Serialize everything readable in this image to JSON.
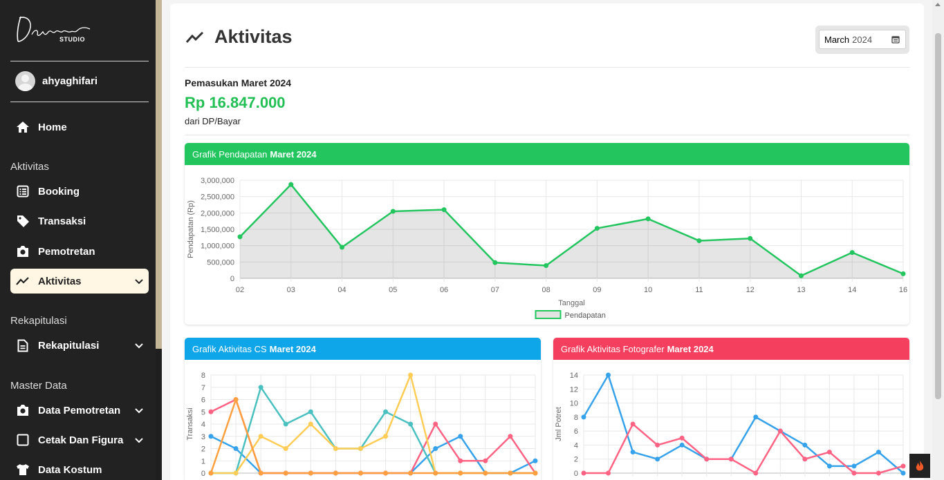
{
  "sidebar": {
    "logo_text": "Danapa STUDIO",
    "user": {
      "name": "ahyaghifari"
    },
    "home": {
      "label": "Home"
    },
    "sections": {
      "aktivitas": "Aktivitas",
      "rekapitulasi": "Rekapitulasi",
      "master": "Master Data"
    },
    "items": {
      "booking": "Booking",
      "transaksi": "Transaksi",
      "pemotretan": "Pemotretan",
      "aktivitas": "Aktivitas",
      "rekapitulasi": "Rekapitulasi",
      "data_pemotretan": "Data Pemotretan",
      "cetak": "Cetak Dan Figura",
      "kostum": "Data Kostum"
    }
  },
  "header": {
    "title": "Aktivitas",
    "month_label": "March",
    "year_label": "2024"
  },
  "income": {
    "title": "Pemasukan Maret 2024",
    "value": "Rp 16.847.000",
    "subtitle": "dari DP/Bayar"
  },
  "colors": {
    "green": "#22c55e",
    "blue": "#0ea5e9",
    "red": "#f43f5e"
  },
  "panels": {
    "revenue": {
      "title": "Grafik Pendapatan",
      "period": "Maret 2024"
    },
    "cs": {
      "title": "Grafik Aktivitas CS",
      "period": "Maret 2024"
    },
    "photo": {
      "title": "Grafik Aktivitas Fotografer",
      "period": "Maret 2024"
    }
  },
  "chart_data": [
    {
      "type": "line",
      "xlabel": "Tanggal",
      "ylabel": "Pendapatan (Rp)",
      "categories": [
        "02",
        "03",
        "04",
        "05",
        "06",
        "07",
        "08",
        "09",
        "10",
        "11",
        "12",
        "13",
        "14",
        "16"
      ],
      "ylim": [
        0,
        3000000
      ],
      "yticks": [
        "0",
        "500,000",
        "1,000,000",
        "1,500,000",
        "2,000,000",
        "2,500,000",
        "3,000,000"
      ],
      "series": [
        {
          "name": "Pendapatan",
          "color": "#22c55e",
          "values": [
            1270000,
            2870000,
            950000,
            2050000,
            2100000,
            480000,
            390000,
            1530000,
            1820000,
            1150000,
            1220000,
            80000,
            790000,
            140000
          ]
        }
      ],
      "legend": "bottom",
      "fill": true
    },
    {
      "type": "line",
      "ylabel": "Transaksi",
      "ylim": [
        0,
        8
      ],
      "yticks": [
        "0",
        "1",
        "2",
        "3",
        "4",
        "5",
        "6",
        "7",
        "8"
      ],
      "points": 14,
      "series": [
        {
          "color": "#36a2eb",
          "values": [
            3,
            2,
            0,
            0,
            0,
            0,
            0,
            0,
            0,
            2,
            3,
            0,
            0,
            1
          ]
        },
        {
          "color": "#ff6384",
          "values": [
            5,
            6,
            0,
            0,
            0,
            0,
            0,
            0,
            0,
            4,
            1,
            1,
            3,
            0
          ]
        },
        {
          "color": "#4bc0c0",
          "values": [
            0,
            0,
            7,
            4,
            5,
            2,
            2,
            5,
            4,
            0,
            0,
            0,
            0,
            0
          ]
        },
        {
          "color": "#ffcd56",
          "values": [
            0,
            0,
            3,
            2,
            4,
            2,
            2,
            3,
            8,
            0,
            0,
            0,
            0,
            0
          ]
        },
        {
          "color": "#ff9f40",
          "values": [
            0,
            6,
            0,
            0,
            0,
            0,
            0,
            0,
            0,
            0,
            0,
            0,
            0,
            0
          ]
        }
      ]
    },
    {
      "type": "line",
      "ylabel": "Jml Potret",
      "ylim": [
        0,
        14
      ],
      "yticks": [
        "0",
        "2",
        "4",
        "6",
        "8",
        "10",
        "12",
        "14"
      ],
      "points": 14,
      "series": [
        {
          "color": "#36a2eb",
          "values": [
            8,
            14,
            3,
            2,
            4,
            2,
            2,
            8,
            6,
            4,
            1,
            1,
            3,
            0
          ]
        },
        {
          "color": "#ff6384",
          "values": [
            0,
            0,
            7,
            4,
            5,
            2,
            2,
            0,
            6,
            2,
            3,
            0,
            0,
            1
          ]
        }
      ]
    }
  ]
}
